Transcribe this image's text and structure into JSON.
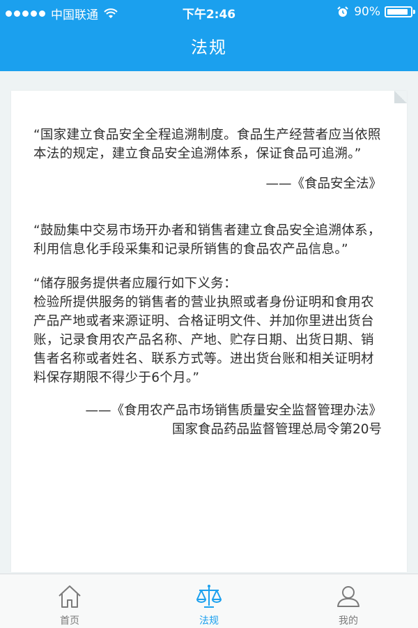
{
  "status_bar": {
    "signal_dots": 5,
    "carrier": "中国联通",
    "time": "下午2:46",
    "battery": "90%",
    "battery_level": 0.9
  },
  "header": {
    "title": "法规"
  },
  "article": {
    "quote1": "“国家建立食品安全全程追溯制度。食品生产经营者应当依照本法的规定，建立食品安全追溯体系，保证食品可追溯。”",
    "source1": "——《食品安全法》",
    "quote2": "“鼓励集中交易市场开办者和销售者建立食品安全追溯体系，利用信息化手段采集和记录所销售的食品农产品信息。”",
    "quote3_line1": "“储存服务提供者应履行如下义务：",
    "quote3_body": "检验所提供服务的销售者的营业执照或者身份证明和食用农产品产地或者来源证明、合格证明文件、并加你里进出货台账，记录食用农产品名称、产地、贮存日期、出货日期、销售者名称或者姓名、联系方式等。进出货台账和相关证明材料保存期限不得少于6个月。”",
    "source3_line1": "——《食用农产品市场销售质量安全监督管理办法》",
    "source3_line2": "国家食品药品监督管理总局令第20号"
  },
  "tabbar": {
    "active_color": "#1ba0ee",
    "inactive_color": "#7a7a7a",
    "items": [
      {
        "label": "首页",
        "icon": "home-icon",
        "active": false
      },
      {
        "label": "法规",
        "icon": "scales-icon",
        "active": true
      },
      {
        "label": "我的",
        "icon": "user-icon",
        "active": false
      }
    ]
  },
  "colors": {
    "header": "#1ba0ee",
    "background": "#eef3f4"
  }
}
